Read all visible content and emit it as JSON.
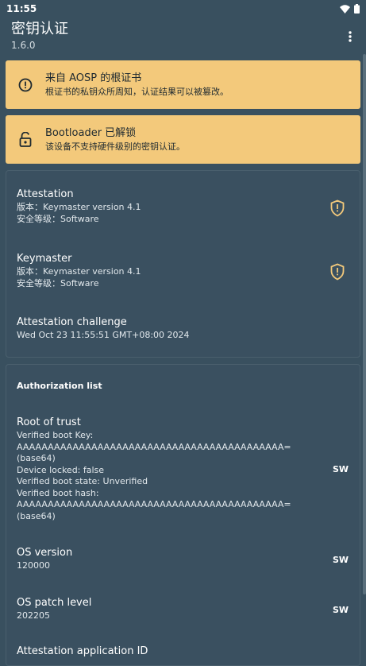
{
  "status_bar": {
    "time": "11:55"
  },
  "app_bar": {
    "title": "密钥认证",
    "version": "1.6.0"
  },
  "warnings": [
    {
      "title": "来自 AOSP 的根证书",
      "desc": "根证书的私钥众所周知，认证结果可以被篡改。",
      "icon": "alert-circle-icon"
    },
    {
      "title": "Bootloader 已解锁",
      "desc": "该设备不支持硬件级别的密钥认证。",
      "icon": "lock-open-icon"
    }
  ],
  "summary": {
    "attestation": {
      "title": "Attestation",
      "version": "版本：Keymaster version 4.1",
      "security": "安全等级：Software"
    },
    "keymaster": {
      "title": "Keymaster",
      "version": "版本：Keymaster version 4.1",
      "security": "安全等级：Software"
    },
    "challenge": {
      "title": "Attestation challenge",
      "value": "Wed Oct 23 11:55:51 GMT+08:00 2024"
    }
  },
  "auth_list": {
    "header": "Authorization list",
    "root_of_trust": {
      "title": "Root of trust",
      "lines": [
        "Verified boot Key:",
        "AAAAAAAAAAAAAAAAAAAAAAAAAAAAAAAAAAAAAAAAAAA=",
        "(base64)",
        "Device locked: false",
        "Verified boot state: Unverified",
        "Verified boot hash:",
        "AAAAAAAAAAAAAAAAAAAAAAAAAAAAAAAAAAAAAAAAAAA=",
        "(base64)"
      ],
      "badge": "SW"
    },
    "os_version": {
      "title": "OS version",
      "value": "120000",
      "badge": "SW"
    },
    "os_patch": {
      "title": "OS patch level",
      "value": "202205",
      "badge": "SW"
    },
    "app_id": {
      "title": "Attestation application ID"
    }
  },
  "colors": {
    "background": "#39505f",
    "warning": "#f3c97b",
    "shield": "#f3c97b"
  }
}
